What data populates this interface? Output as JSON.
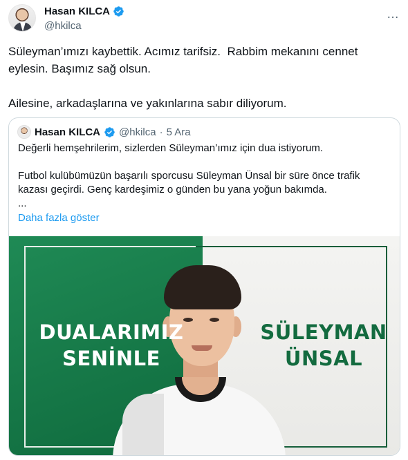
{
  "author": {
    "name": "Hasan KILCA",
    "handle": "@hkilca"
  },
  "more_icon": "…",
  "tweet": {
    "text": "Süleyman’ımızı kaybettik. Acımız tarifsiz.  Rabbim mekanını cennet\neylesin. Başımız sağ olsun.\n\nAilesine, arkadaşlarına ve yakınlarına sabır diliyorum."
  },
  "quote": {
    "name": "Hasan KILCA",
    "handle": "@hkilca",
    "separator": "·",
    "date": "5 Ara",
    "text": "Değerli hemşehrilerim, sizlerden Süleyman’ımız için dua istiyorum.\n\nFutbol kulübümüzün başarılı sporcusu Süleyman Ünsal bir süre önce trafik\nkazası geçirdi. Genç kardeşimiz o günden bu yana yoğun bakımda.\n...",
    "show_more": "Daha fazla göster",
    "media": {
      "slogan_line1": "DUALARIMIZ",
      "slogan_line2": "SENİNLE",
      "player_first": "SÜLEYMAN",
      "player_last": "ÜNSAL"
    }
  },
  "colors": {
    "verified": "#1d9bf0",
    "link": "#1d9bf0",
    "club_green": "#136b3f"
  },
  "icons": {
    "verified": "verified-badge-icon",
    "more": "more-options-icon"
  }
}
